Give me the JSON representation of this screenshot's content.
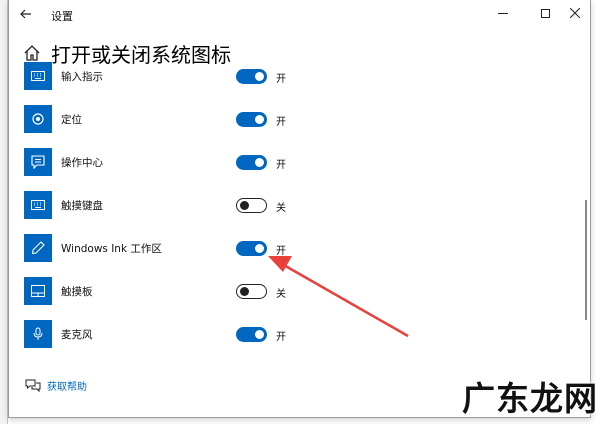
{
  "window": {
    "title": "设置"
  },
  "header": {
    "title": "打开或关闭系统图标"
  },
  "items": [
    {
      "label": "输入指示",
      "state_label": "开",
      "on": true,
      "icon": "keyboard-icon"
    },
    {
      "label": "定位",
      "state_label": "开",
      "on": true,
      "icon": "location-icon"
    },
    {
      "label": "操作中心",
      "state_label": "开",
      "on": true,
      "icon": "action-center-icon"
    },
    {
      "label": "触摸键盘",
      "state_label": "关",
      "on": false,
      "icon": "touch-keyboard-icon"
    },
    {
      "label": "Windows Ink 工作区",
      "state_label": "开",
      "on": true,
      "icon": "pen-icon"
    },
    {
      "label": "触摸板",
      "state_label": "关",
      "on": false,
      "icon": "touchpad-icon"
    },
    {
      "label": "麦克风",
      "state_label": "开",
      "on": true,
      "icon": "microphone-icon"
    }
  ],
  "help": {
    "label": "获取帮助"
  },
  "watermark": {
    "text": "广东龙网"
  },
  "colors": {
    "accent": "#0067c0",
    "arrow": "#e8403a"
  }
}
